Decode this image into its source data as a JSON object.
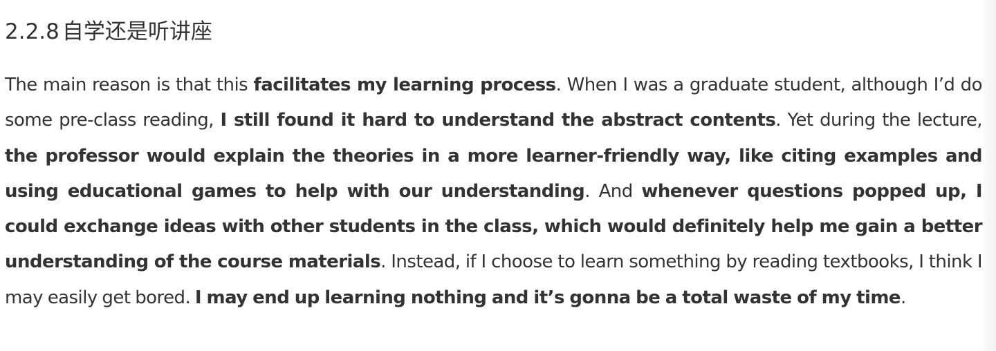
{
  "heading": {
    "number": "2.2.8",
    "title": "自学还是听讲座"
  },
  "paragraph": [
    {
      "text": "The main reason is that this ",
      "bold": false
    },
    {
      "text": "facilitates my learning process",
      "bold": true
    },
    {
      "text": ". When I was a graduate student, although I’d do some pre-class reading, ",
      "bold": false
    },
    {
      "text": "I still found it hard to understand the abstract contents",
      "bold": true
    },
    {
      "text": ". Yet during the lecture, ",
      "bold": false
    },
    {
      "text": "the professor would explain the theories in a more learner-friendly way, like citing examples and using educational games to help with our understanding",
      "bold": true
    },
    {
      "text": ". And ",
      "bold": false
    },
    {
      "text": "whenever questions popped up, I could exchange ideas with other students in the class, which would definitely help me gain a better understanding of the course materials",
      "bold": true
    },
    {
      "text": ". Instead, if I choose to learn something by reading textbooks, I think I may easily get bored. ",
      "bold": false
    },
    {
      "text": "I may end up learning nothing and it’s gonna be a total waste of my time",
      "bold": true
    },
    {
      "text": ".",
      "bold": false
    }
  ]
}
